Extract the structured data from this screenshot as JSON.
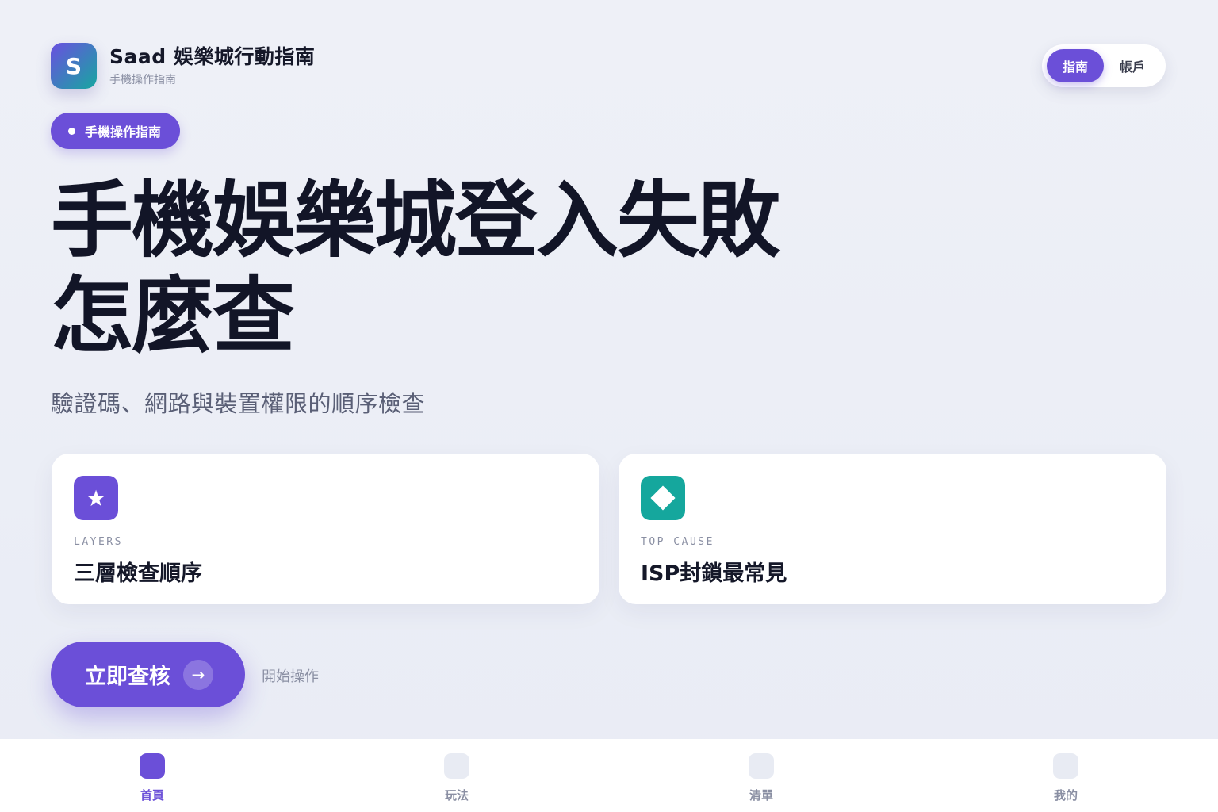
{
  "header": {
    "logo_letter": "S",
    "title": "Saad 娛樂城行動指南",
    "subtitle": "手機操作指南",
    "segments": [
      {
        "label": "指南",
        "active": true
      },
      {
        "label": "帳戶",
        "active": false
      }
    ]
  },
  "tag": {
    "label": "手機操作指南"
  },
  "hero": {
    "title_line1": "手機娛樂城登入失敗",
    "title_line2": "怎麼查",
    "subtitle": "驗證碼、網路與裝置權限的順序檢查"
  },
  "cards": [
    {
      "icon": "star-icon",
      "eyebrow": "LAYERS",
      "title": "三層檢查順序",
      "icon_color": "#6b4fd8"
    },
    {
      "icon": "diamond-icon",
      "eyebrow": "TOP CAUSE",
      "title": "ISP封鎖最常見",
      "icon_color": "#15a79d"
    }
  ],
  "cta": {
    "label": "立即查核",
    "arrow": "→",
    "note": "開始操作"
  },
  "bottom_nav": [
    {
      "label": "首頁",
      "active": true
    },
    {
      "label": "玩法",
      "active": false
    },
    {
      "label": "清單",
      "active": false
    },
    {
      "label": "我的",
      "active": false
    }
  ],
  "colors": {
    "accent": "#6b4fd8",
    "teal": "#15a79d",
    "text": "#121527",
    "muted": "#8a8fa3"
  }
}
